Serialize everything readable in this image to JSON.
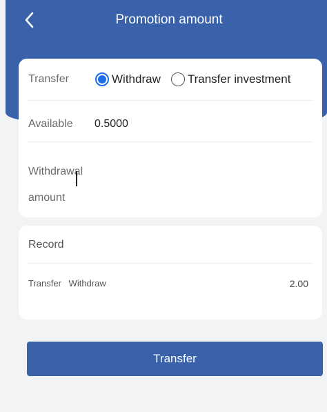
{
  "header": {
    "title": "Promotion amount",
    "background_color": "#3a62ab",
    "back_icon": "chevron-left-icon"
  },
  "transfer_card": {
    "type_label": "Transfer",
    "options": [
      {
        "label": "Withdraw",
        "selected": true
      },
      {
        "label": "Transfer investment",
        "selected": false
      }
    ],
    "available_label": "Available",
    "available_value": "0.5000",
    "amount_label": "Withdrawal amount",
    "amount_value": ""
  },
  "record_card": {
    "title": "Record",
    "rows": [
      {
        "type": "Transfer",
        "status": "Withdraw",
        "amount": "2.00"
      }
    ]
  },
  "submit_button": {
    "label": "Transfer",
    "color": "#3a62ab"
  },
  "colors": {
    "accent": "#1a6ee8",
    "page_background": "#f2f3f5"
  }
}
